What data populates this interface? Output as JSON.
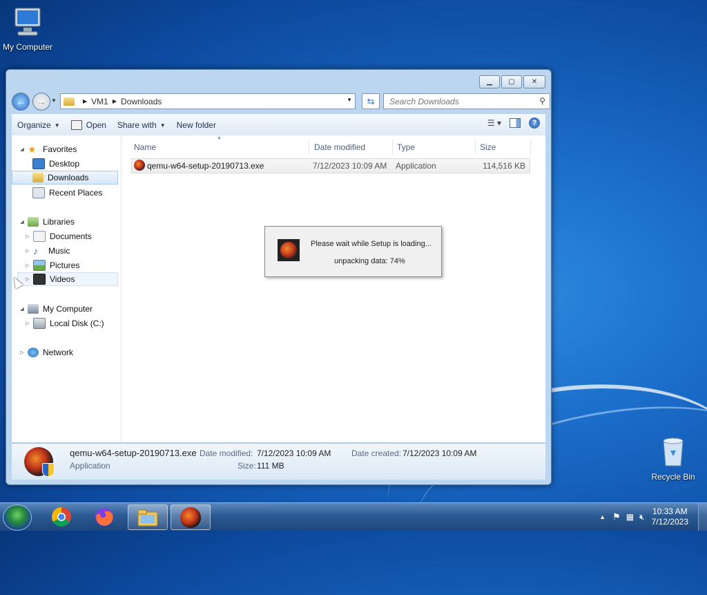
{
  "desktop": {
    "icons": [
      {
        "label": "My Computer",
        "icon": "computer-icon"
      },
      {
        "label": "Recycle Bin",
        "icon": "recycle-bin-icon"
      }
    ]
  },
  "window": {
    "caption_buttons": [
      "minimize",
      "maximize",
      "close"
    ],
    "address": {
      "crumbs": [
        "VM1",
        "Downloads"
      ]
    },
    "search": {
      "placeholder": "Search Downloads"
    },
    "toolbar": {
      "organize": "Organize",
      "open": "Open",
      "share_with": "Share with",
      "new_folder": "New folder"
    },
    "nav": {
      "favorites": "Favorites",
      "desktop": "Desktop",
      "downloads": "Downloads",
      "recent_places": "Recent Places",
      "libraries": "Libraries",
      "documents": "Documents",
      "music": "Music",
      "pictures": "Pictures",
      "videos": "Videos",
      "my_computer": "My Computer",
      "local_disk": "Local Disk (C:)",
      "network": "Network"
    },
    "columns": [
      "Name",
      "Date modified",
      "Type",
      "Size"
    ],
    "files": [
      {
        "name": "qemu-w64-setup-20190713.exe",
        "date_modified": "7/12/2023 10:09 AM",
        "type": "Application",
        "size": "114,516 KB"
      }
    ],
    "details": {
      "name": "qemu-w64-setup-20190713.exe",
      "type": "Application",
      "date_modified_label": "Date modified:",
      "date_modified": "7/12/2023 10:09 AM",
      "date_created_label": "Date created:",
      "date_created": "7/12/2023 10:09 AM",
      "size_label": "Size:",
      "size": "111 MB"
    }
  },
  "dialog": {
    "message": "Please wait while Setup is loading...",
    "status": "unpacking data: 74%",
    "progress_percent": 74
  },
  "taskbar": {
    "apps": [
      "start-button",
      "chrome-icon",
      "firefox-icon",
      "explorer-icon",
      "qemu-setup-icon"
    ],
    "time": "10:33 AM",
    "date": "7/12/2023"
  }
}
